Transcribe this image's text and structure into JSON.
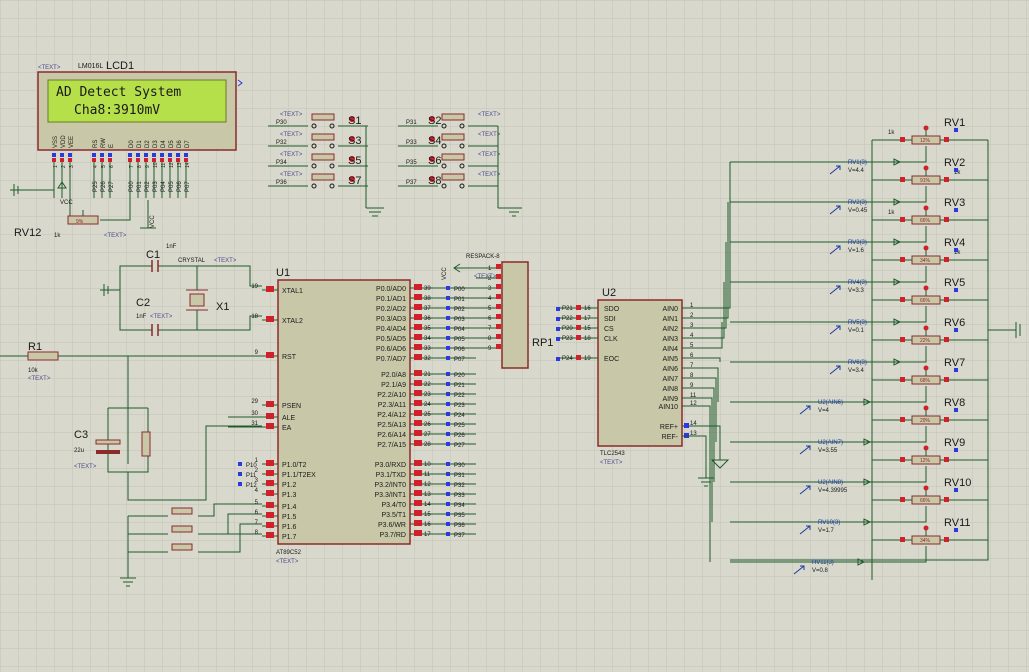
{
  "lcd": {
    "ref": "LCD1",
    "model": "LM016L",
    "line1": "AD Detect System",
    "line2": "Cha8:3910mV",
    "pins": [
      "VSS",
      "VDD",
      "VEE",
      "RS",
      "RW",
      "E",
      "D0",
      "D1",
      "D2",
      "D3",
      "D4",
      "D5",
      "D6",
      "D7"
    ],
    "pin_nums": [
      "1",
      "2",
      "3",
      "4",
      "5",
      "6",
      "7",
      "8",
      "9",
      "10",
      "11",
      "12",
      "13",
      "14"
    ],
    "port_labels": [
      "P25",
      "P26",
      "P27",
      "P00",
      "P01",
      "P02",
      "P03",
      "P04",
      "P05",
      "P06",
      "P07"
    ]
  },
  "text_tag": "<TEXT>",
  "rv12": {
    "ref": "RV12",
    "value": "1k",
    "vcc": "VCC"
  },
  "switches": [
    {
      "ref": "S1",
      "net": "P30"
    },
    {
      "ref": "S2",
      "net": "P31"
    },
    {
      "ref": "S3",
      "net": "P32"
    },
    {
      "ref": "S4",
      "net": "P33"
    },
    {
      "ref": "S5",
      "net": "P34"
    },
    {
      "ref": "S6",
      "net": "P35"
    },
    {
      "ref": "S7",
      "net": "P36"
    },
    {
      "ref": "S8",
      "net": "P37"
    }
  ],
  "c1": {
    "ref": "C1",
    "value": "1nF"
  },
  "c2": {
    "ref": "C2",
    "value": "1nF"
  },
  "crystal": {
    "ref": "X1",
    "label": "CRYSTAL"
  },
  "r1": {
    "ref": "R1",
    "value": "10k"
  },
  "c3": {
    "ref": "C3",
    "value": "22u"
  },
  "u1": {
    "ref": "U1",
    "part": "AT89C52",
    "left_pins": [
      {
        "num": "19",
        "name": "XTAL1"
      },
      {
        "num": "18",
        "name": "XTAL2"
      },
      {
        "num": "9",
        "name": "RST"
      },
      {
        "num": "29",
        "name": "PSEN"
      },
      {
        "num": "30",
        "name": "ALE"
      },
      {
        "num": "31",
        "name": "EA"
      },
      {
        "num": "1",
        "name": "P1.0/T2",
        "net": "P10"
      },
      {
        "num": "2",
        "name": "P1.1/T2EX",
        "net": "P11"
      },
      {
        "num": "3",
        "name": "P1.2",
        "net": "P12"
      },
      {
        "num": "4",
        "name": "P1.3"
      },
      {
        "num": "5",
        "name": "P1.4"
      },
      {
        "num": "6",
        "name": "P1.5"
      },
      {
        "num": "7",
        "name": "P1.6"
      },
      {
        "num": "8",
        "name": "P1.7"
      }
    ],
    "right_pins": [
      {
        "num": "39",
        "name": "P0.0/AD0",
        "net": "P00"
      },
      {
        "num": "38",
        "name": "P0.1/AD1",
        "net": "P01"
      },
      {
        "num": "37",
        "name": "P0.2/AD2",
        "net": "P02"
      },
      {
        "num": "36",
        "name": "P0.3/AD3",
        "net": "P03"
      },
      {
        "num": "35",
        "name": "P0.4/AD4",
        "net": "P04"
      },
      {
        "num": "34",
        "name": "P0.5/AD5",
        "net": "P05"
      },
      {
        "num": "33",
        "name": "P0.6/AD6",
        "net": "P06"
      },
      {
        "num": "32",
        "name": "P0.7/AD7",
        "net": "P07"
      },
      {
        "num": "21",
        "name": "P2.0/A8",
        "net": "P20"
      },
      {
        "num": "22",
        "name": "P2.1/A9",
        "net": "P21"
      },
      {
        "num": "23",
        "name": "P2.2/A10",
        "net": "P22"
      },
      {
        "num": "24",
        "name": "P2.3/A11",
        "net": "P23"
      },
      {
        "num": "25",
        "name": "P2.4/A12",
        "net": "P24"
      },
      {
        "num": "26",
        "name": "P2.5/A13",
        "net": "P25"
      },
      {
        "num": "27",
        "name": "P2.6/A14",
        "net": "P26"
      },
      {
        "num": "28",
        "name": "P2.7/A15",
        "net": "P27"
      },
      {
        "num": "10",
        "name": "P3.0/RXD",
        "net": "P30"
      },
      {
        "num": "11",
        "name": "P3.1/TXD",
        "net": "P31"
      },
      {
        "num": "12",
        "name": "P3.2/INT0",
        "net": "P32"
      },
      {
        "num": "13",
        "name": "P3.3/INT1",
        "net": "P33"
      },
      {
        "num": "14",
        "name": "P3.4/T0",
        "net": "P34"
      },
      {
        "num": "15",
        "name": "P3.5/T1",
        "net": "P35"
      },
      {
        "num": "16",
        "name": "P3.6/WR",
        "net": "P36"
      },
      {
        "num": "17",
        "name": "P3.7/RD",
        "net": "P37"
      }
    ]
  },
  "rp1": {
    "ref": "RP1",
    "part": "RESPACK-8",
    "vcc": "VCC",
    "pin_nums": [
      "1",
      "2",
      "3",
      "4",
      "5",
      "6",
      "7",
      "8",
      "9"
    ]
  },
  "u2": {
    "ref": "U2",
    "part": "TLC2543",
    "left_pins": [
      {
        "num": "16",
        "name": "SDO",
        "net": "P21"
      },
      {
        "num": "17",
        "name": "SDI",
        "net": "P22"
      },
      {
        "num": "15",
        "name": "CS",
        "net": "P20"
      },
      {
        "num": "18",
        "name": "CLK",
        "net": "P23"
      },
      {
        "num": "19",
        "name": "EOC",
        "net": "P24"
      }
    ],
    "right_pins": [
      {
        "num": "1",
        "name": "AIN0"
      },
      {
        "num": "2",
        "name": "AIN1"
      },
      {
        "num": "3",
        "name": "AIN2"
      },
      {
        "num": "4",
        "name": "AIN3"
      },
      {
        "num": "5",
        "name": "AIN4"
      },
      {
        "num": "6",
        "name": "AIN5"
      },
      {
        "num": "7",
        "name": "AIN6"
      },
      {
        "num": "8",
        "name": "AIN7"
      },
      {
        "num": "9",
        "name": "AIN8"
      },
      {
        "num": "11",
        "name": "AIN9"
      },
      {
        "num": "12",
        "name": "AIN10"
      },
      {
        "num": "14",
        "name": "REF+"
      },
      {
        "num": "13",
        "name": "REF-"
      }
    ]
  },
  "pots": [
    {
      "ref": "RV1",
      "value": "1k",
      "pct": "12%"
    },
    {
      "ref": "RV2",
      "value": "1k",
      "pct": "91%"
    },
    {
      "ref": "RV3",
      "value": "1k",
      "pct": "66%"
    },
    {
      "ref": "RV4",
      "value": "1k",
      "pct": "34%"
    },
    {
      "ref": "RV5",
      "value": "",
      "pct": "66%"
    },
    {
      "ref": "RV6",
      "value": "",
      "pct": "22%"
    },
    {
      "ref": "RV7",
      "value": "",
      "pct": "68%"
    },
    {
      "ref": "RV8",
      "value": "",
      "pct": "29%"
    },
    {
      "ref": "RV9",
      "value": "",
      "pct": "12%"
    },
    {
      "ref": "RV10",
      "value": "",
      "pct": "66%"
    },
    {
      "ref": "RV11",
      "value": "",
      "pct": "34%"
    }
  ],
  "probes": [
    {
      "name": "RV1(3)",
      "value": "V=4.4"
    },
    {
      "name": "RV2(3)",
      "value": "V=0.45"
    },
    {
      "name": "RV3(3)",
      "value": "V=1.6"
    },
    {
      "name": "RV4(3)",
      "value": "V=3.3"
    },
    {
      "name": "RV5(3)",
      "value": "V=0.1"
    },
    {
      "name": "RV6(3)",
      "value": "V=3.4"
    },
    {
      "name": "U2(AIN6)",
      "value": "V=4"
    },
    {
      "name": "U2(AIN7)",
      "value": "V=3.55"
    },
    {
      "name": "U2(AIN8)",
      "value": "V=4.39995"
    },
    {
      "name": "RV10(3)",
      "value": "V=1.7"
    },
    {
      "name": "RV11(3)",
      "value": "V=0.8"
    }
  ],
  "colors": {
    "background": "#d8d8cc",
    "grid": "#c4c4b8",
    "wire": "#1e5a2a",
    "component_fill": "#c8c8a8",
    "component_outline": "#8b2a2a",
    "lcd_screen": "#b6e04a",
    "pin_red": "#d0202a",
    "pin_blue": "#2a3ae0",
    "probe": "#1a3aa0"
  }
}
